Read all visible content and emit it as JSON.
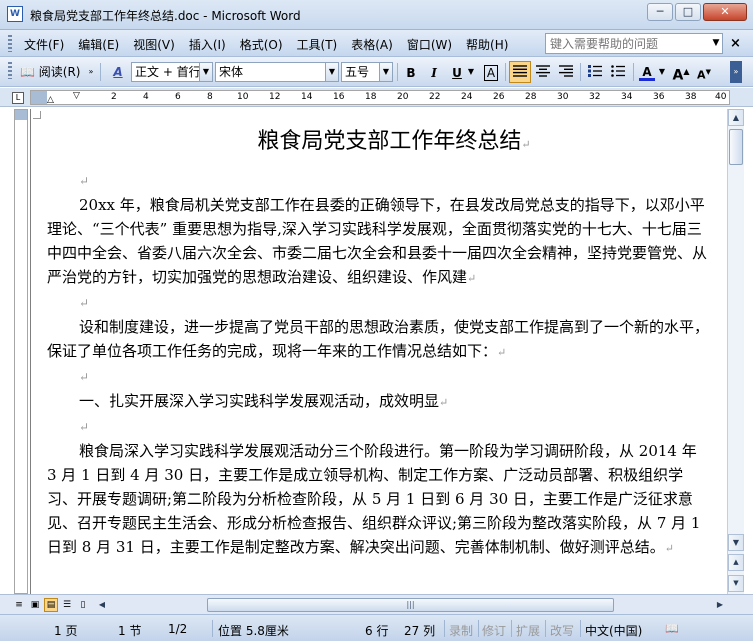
{
  "window": {
    "title": "粮食局党支部工作年终总结.doc - Microsoft Word",
    "icon_label": "W",
    "minimize": "─",
    "maximize": "□",
    "close": "✕"
  },
  "menu": {
    "items": [
      "文件(F)",
      "编辑(E)",
      "视图(V)",
      "插入(I)",
      "格式(O)",
      "工具(T)",
      "表格(A)",
      "窗口(W)",
      "帮助(H)"
    ],
    "help_placeholder": "键入需要帮助的问题",
    "doc_close": "×"
  },
  "toolbar": {
    "reading_mode": "阅读(R)",
    "style_value": "正文 + 首行",
    "font_value": "宋体",
    "size_value": "五号",
    "bold": "B",
    "italic": "I",
    "underline": "U",
    "char_border": "A",
    "font_color": "A",
    "grow_font": "A",
    "shrink_font": "A",
    "style_icon": "A"
  },
  "ruler": {
    "numbers": [
      "2",
      "4",
      "6",
      "8",
      "10",
      "12",
      "14",
      "16",
      "18",
      "20",
      "22",
      "24",
      "26",
      "28",
      "30",
      "32",
      "34",
      "36",
      "38",
      "40"
    ],
    "corner": "L"
  },
  "document": {
    "title": "粮食局党支部工作年终总结",
    "para_mark": "↵",
    "paragraphs": [
      "20xx 年，粮食局机关党支部工作在县委的正确领导下，在县发改局党总支的指导下，以邓小平理论、“三个代表” 重要思想为指导,深入学习实践科学发展观，全面贯彻落实党的十七大、十七届三中四中全会、省委八届六次全会、市委二届七次全会和县委十一届四次全会精神，坚持党要管党、从严治党的方针，切实加强党的思想政治建设、组织建设、作风建",
      "设和制度建设，进一步提高了党员干部的思想政治素质，使党支部工作提高到了一个新的水平，保证了单位各项工作任务的完成，现将一年来的工作情况总结如下：",
      "一、扎实开展深入学习实践科学发展观活动，成效明显",
      "粮食局深入学习实践科学发展观活动分三个阶段进行。第一阶段为学习调研阶段，从 2014 年 3 月 1 日到 4 月 30 日，主要工作是成立领导机构、制定工作方案、广泛动员部署、积极组织学习、开展专题调研;第二阶段为分析检查阶段，从 5 月 1 日到 6 月 30 日，主要工作是广泛征求意见、召开专题民主生活会、形成分析检查报告、组织群众评议;第三阶段为整改落实阶段，从 7 月 1 日到 8 月 31 日，主要工作是制定整改方案、解决突出问题、完善体制机制、做好测评总结。"
    ]
  },
  "hscroll": {
    "left": "◀",
    "right": "▶",
    "thumb_grip": "|||"
  },
  "vscroll": {
    "up": "▲",
    "down": "▼",
    "prev": "▲",
    "next": "▼"
  },
  "status": {
    "page": "1 页",
    "section": "1 节",
    "page_of": "1/2",
    "position": "位置 5.8厘米",
    "line": "6 行",
    "column": "27 列",
    "record": "录制",
    "revise": "修订",
    "extend": "扩展",
    "overtype": "改写",
    "language": "中文(中国)"
  },
  "colors": {
    "highlight": "#fbd68a",
    "font_color_bar": "#1a2bd6",
    "title_bar": "#c8d9ee"
  }
}
